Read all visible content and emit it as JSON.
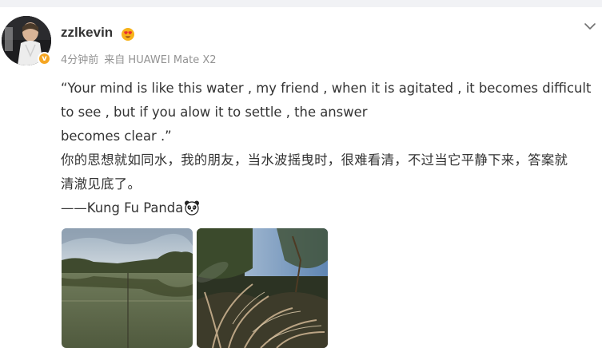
{
  "post": {
    "username": "zzlkevin",
    "time": "4分钟前",
    "source": "来自 HUAWEI Mate X2",
    "lines_en": [
      "“Your mind is like this water , my friend , when it is agitated , it becomes difficult",
      "to see , but if you alow it to settle , the answer",
      "becomes clear .”"
    ],
    "lines_cn": [
      "你的思想就如同水，我的朋友，当水波摇曳时，很难看清，不过当它平静下来，答案就",
      "清澈见底了。"
    ],
    "attribution": "——Kung Fu Panda"
  },
  "icons": {
    "verified": "verified-v-badge",
    "level": "heart-eyes-level-icon",
    "menu": "chevron-down-icon",
    "emoji": "panda-emoji"
  },
  "colors": {
    "meta": "#939393",
    "text": "#333333",
    "badge": "#f5a623"
  }
}
